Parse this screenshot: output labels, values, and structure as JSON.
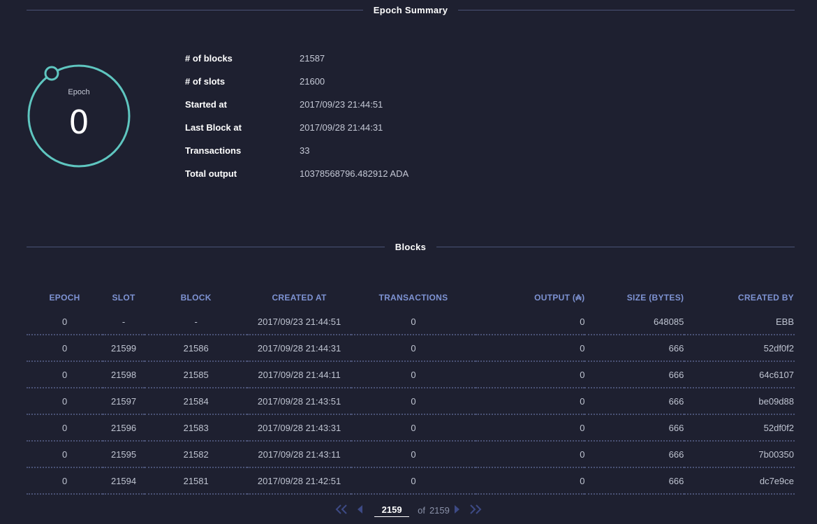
{
  "summary_section": {
    "title": "Epoch Summary"
  },
  "epoch": {
    "label": "Epoch",
    "number": "0"
  },
  "summary": [
    {
      "key": "# of blocks",
      "value": "21587"
    },
    {
      "key": "# of slots",
      "value": "21600"
    },
    {
      "key": "Started at",
      "value": "2017/09/23 21:44:51"
    },
    {
      "key": "Last Block at",
      "value": "2017/09/28 21:44:31"
    },
    {
      "key": "Transactions",
      "value": "33"
    },
    {
      "key": "Total output",
      "value": "10378568796.482912 ADA"
    }
  ],
  "blocks_section": {
    "title": "Blocks"
  },
  "table": {
    "headers": [
      "EPOCH",
      "SLOT",
      "BLOCK",
      "CREATED AT",
      "TRANSACTIONS",
      "OUTPUT (₳)",
      "SIZE (BYTES)",
      "CREATED BY"
    ],
    "rows": [
      [
        "0",
        "-",
        "-",
        "2017/09/23 21:44:51",
        "0",
        "0",
        "648085",
        "EBB"
      ],
      [
        "0",
        "21599",
        "21586",
        "2017/09/28 21:44:31",
        "0",
        "0",
        "666",
        "52df0f2"
      ],
      [
        "0",
        "21598",
        "21585",
        "2017/09/28 21:44:11",
        "0",
        "0",
        "666",
        "64c6107"
      ],
      [
        "0",
        "21597",
        "21584",
        "2017/09/28 21:43:51",
        "0",
        "0",
        "666",
        "be09d88"
      ],
      [
        "0",
        "21596",
        "21583",
        "2017/09/28 21:43:31",
        "0",
        "0",
        "666",
        "52df0f2"
      ],
      [
        "0",
        "21595",
        "21582",
        "2017/09/28 21:43:11",
        "0",
        "0",
        "666",
        "7b00350"
      ],
      [
        "0",
        "21594",
        "21581",
        "2017/09/28 21:42:51",
        "0",
        "0",
        "666",
        "dc7e9ce"
      ]
    ]
  },
  "pager": {
    "first_icon": "double-chevron-left-icon",
    "prev_icon": "triangle-left-icon",
    "current_page": "2159",
    "of_label": "of",
    "total_pages": "2159",
    "next_icon": "triangle-right-icon",
    "last_icon": "double-chevron-right-icon"
  },
  "colors": {
    "background": "#1e2030",
    "accent_teal": "#5fc6c0",
    "header_blue": "#7e93d3",
    "divider": "#4a5275"
  }
}
